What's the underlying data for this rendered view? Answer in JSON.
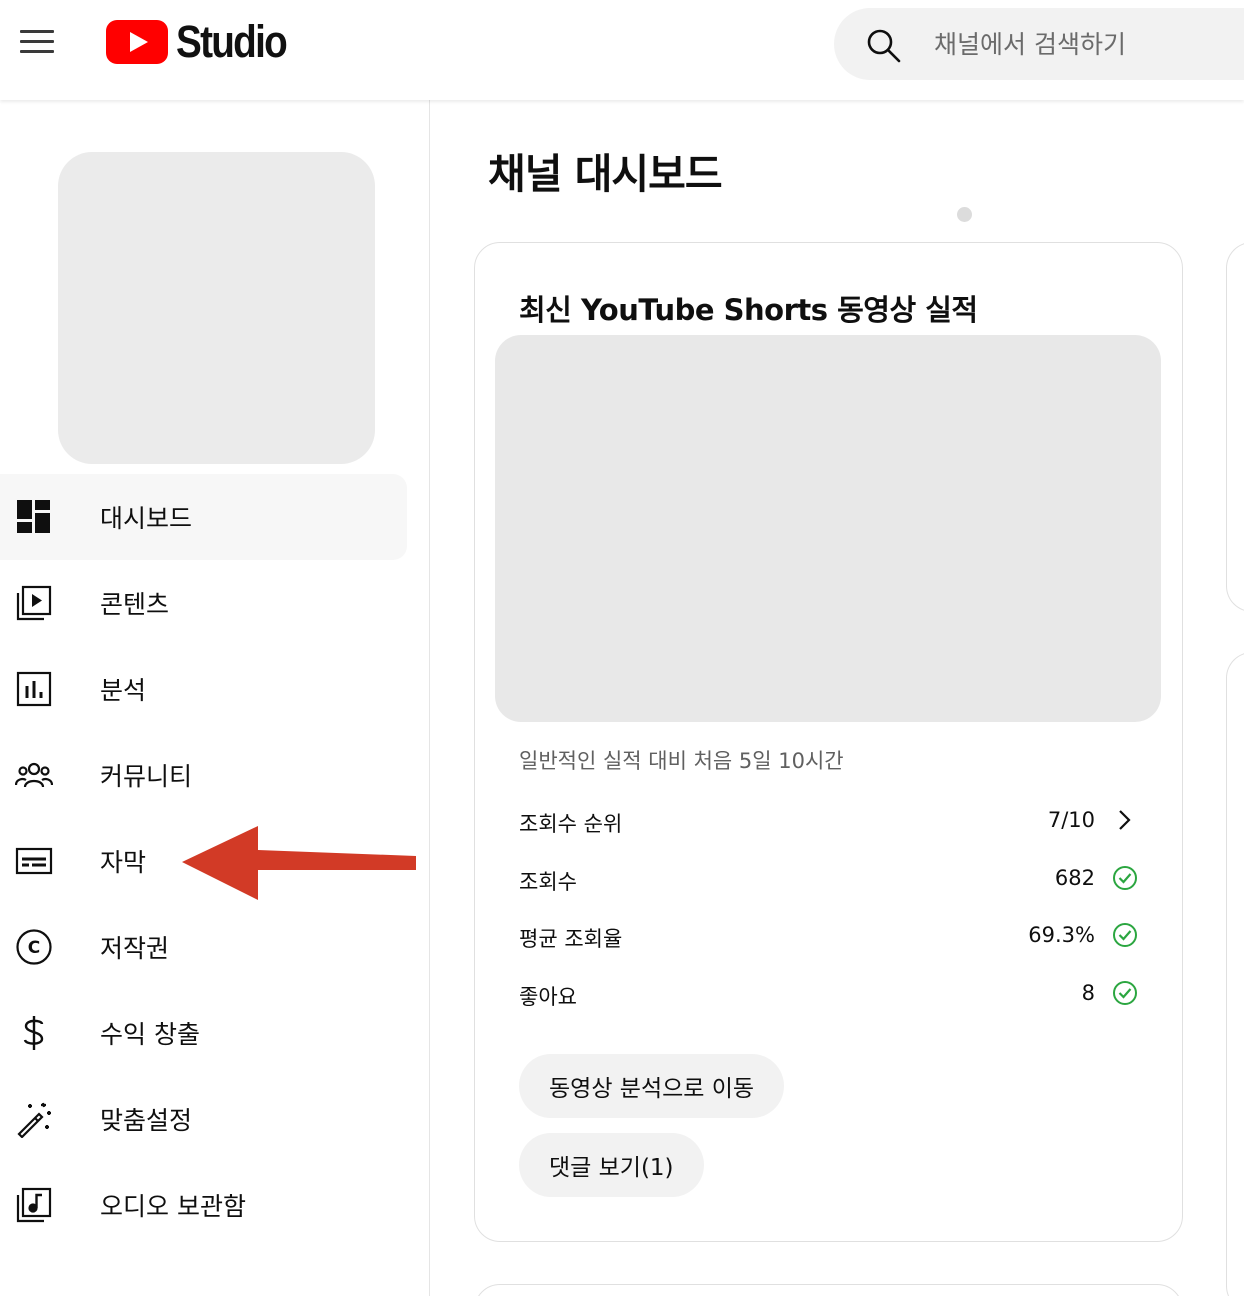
{
  "header": {
    "logo_text": "Studio",
    "search_placeholder": "채널에서 검색하기"
  },
  "sidebar": {
    "items": [
      {
        "label": "대시보드",
        "icon": "dashboard-icon",
        "active": true
      },
      {
        "label": "콘텐츠",
        "icon": "content-icon"
      },
      {
        "label": "분석",
        "icon": "analytics-icon"
      },
      {
        "label": "커뮤니티",
        "icon": "community-icon"
      },
      {
        "label": "자막",
        "icon": "subtitles-icon"
      },
      {
        "label": "저작권",
        "icon": "copyright-icon"
      },
      {
        "label": "수익 창출",
        "icon": "dollar-icon"
      },
      {
        "label": "맞춤설정",
        "icon": "magic-wand-icon"
      },
      {
        "label": "오디오 보관함",
        "icon": "audio-library-icon"
      }
    ]
  },
  "main": {
    "title": "채널 대시보드",
    "card": {
      "title": "최신 YouTube Shorts 동영상 실적",
      "subnote": "일반적인 실적 대비 처음 5일 10시간",
      "metrics": [
        {
          "label": "조회수 순위",
          "value": "7/10",
          "icon": "chevron-right-icon"
        },
        {
          "label": "조회수",
          "value": "682",
          "icon": "check-circle-icon"
        },
        {
          "label": "평균 조회율",
          "value": "69.3%",
          "icon": "check-circle-icon"
        },
        {
          "label": "좋아요",
          "value": "8",
          "icon": "check-circle-icon"
        }
      ],
      "buttons": {
        "analytics": "동영상 분석으로 이동",
        "comments": "댓글 보기(1)"
      }
    }
  },
  "colors": {
    "brand_red": "#ff0000",
    "check_green": "#2ba640",
    "annotation_arrow": "#d23a26"
  }
}
